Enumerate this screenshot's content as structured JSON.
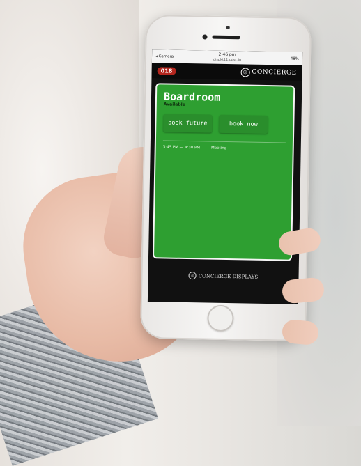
{
  "status_bar": {
    "carrier": "◂ Camera",
    "time": "2:46 pm",
    "battery": "48%",
    "url": "dispkt11.cdsc.io"
  },
  "app": {
    "room_badge": "018",
    "brand": "CONCIERGE",
    "footer_brand": "CONCIERGE DISPLAYS"
  },
  "room": {
    "name": "Boardroom",
    "status": "Available",
    "buttons": {
      "book_future": "book future",
      "book_now": "book now"
    },
    "events": [
      {
        "time": "3:45 PM — 4:30 PM",
        "title": "Meeting"
      }
    ]
  },
  "colors": {
    "available_green": "#2e9f31",
    "badge_red": "#b3261e",
    "header_black": "#0b0b0b"
  }
}
